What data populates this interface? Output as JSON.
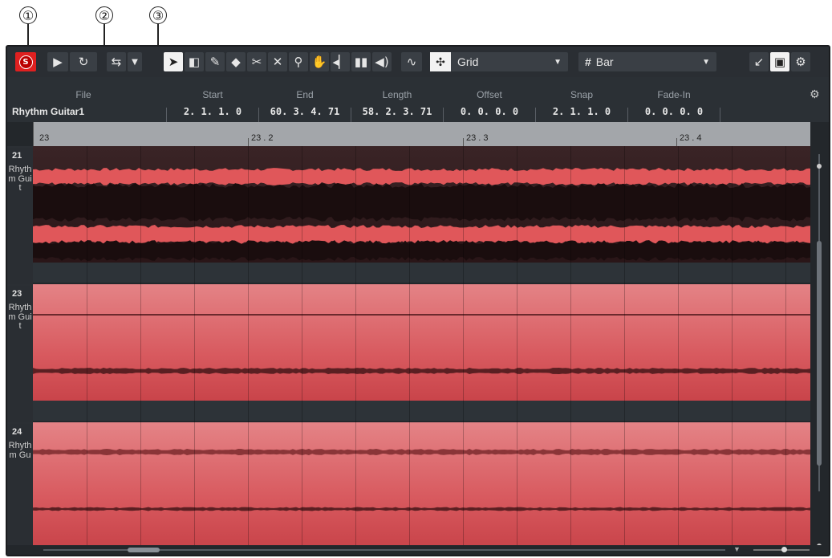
{
  "callouts": [
    "①",
    "②",
    "③"
  ],
  "toolbar": {
    "solo_label": "S",
    "grid_label": "Grid",
    "bar_label": "Bar",
    "icons": [
      "solo-icon",
      "play-icon",
      "loop-icon",
      "autoscroll-icon",
      "dropdown-icon",
      "select-icon",
      "range-icon",
      "draw-icon",
      "erase-icon",
      "split-icon",
      "mute-tool-icon",
      "zoom-icon",
      "hand-icon",
      "audition-icon",
      "warp-icon",
      "speaker-icon",
      "snap-icon",
      "grid-icon",
      "quantize-icon",
      "collapse-icon",
      "window-icon",
      "gear-icon"
    ]
  },
  "info": {
    "file_label": "File",
    "file_value": "Rhythm Guitar1",
    "fields": [
      {
        "label": "Start",
        "value": "2. 1. 1.   0"
      },
      {
        "label": "End",
        "value": "60. 3. 4. 71"
      },
      {
        "label": "Length",
        "value": "58. 2. 3. 71"
      },
      {
        "label": "Offset",
        "value": "0. 0. 0.   0"
      },
      {
        "label": "Snap",
        "value": "2. 1. 1.   0"
      },
      {
        "label": "Fade-In",
        "value": "0. 0. 0.   0"
      }
    ]
  },
  "ruler": {
    "labels": [
      "23",
      "23 . 2",
      "23 . 3",
      "23 . 4"
    ]
  },
  "lanes": [
    {
      "number": "21",
      "name": "Rhythm Guit"
    },
    {
      "number": "23",
      "name": "Rhythm Guit"
    },
    {
      "number": "24",
      "name": "Rhythm Gu"
    }
  ],
  "colors": {
    "accent": "#e02020",
    "waveform": "#e0575a",
    "background": "#23272b"
  }
}
